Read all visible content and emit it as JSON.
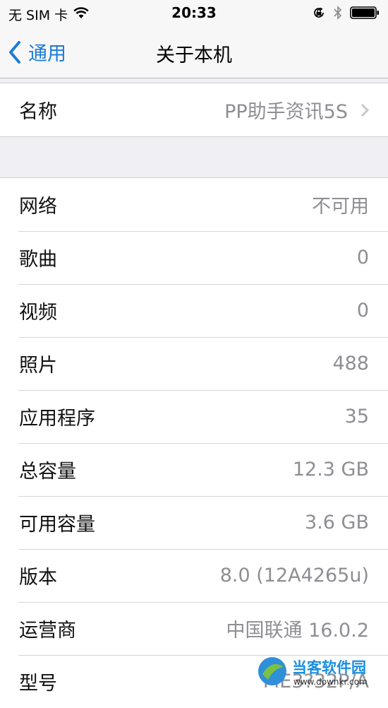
{
  "status_bar": {
    "carrier": "无 SIM 卡",
    "time": "20:33",
    "icons": [
      "wifi-icon",
      "orientation-lock-icon",
      "bluetooth-icon",
      "battery-icon"
    ]
  },
  "nav": {
    "back_label": "通用",
    "title": "关于本机"
  },
  "name_row": {
    "label": "名称",
    "value": "PP助手资讯5S"
  },
  "info_rows": [
    {
      "label": "网络",
      "value": "不可用"
    },
    {
      "label": "歌曲",
      "value": "0"
    },
    {
      "label": "视频",
      "value": "0"
    },
    {
      "label": "照片",
      "value": "488"
    },
    {
      "label": "应用程序",
      "value": "35"
    },
    {
      "label": "总容量",
      "value": "12.3 GB"
    },
    {
      "label": "可用容量",
      "value": "3.6 GB"
    },
    {
      "label": "版本",
      "value": "8.0 (12A4265u)"
    },
    {
      "label": "运营商",
      "value": "中国联通 16.0.2"
    },
    {
      "label": "型号",
      "value": "ME3?32P/A"
    }
  ],
  "watermark": {
    "title": "当客软件园",
    "url": "www.downkr.com"
  },
  "colors": {
    "accent": "#1a7bd6",
    "background": "#efeff4",
    "value_gray": "#8e8e93"
  }
}
